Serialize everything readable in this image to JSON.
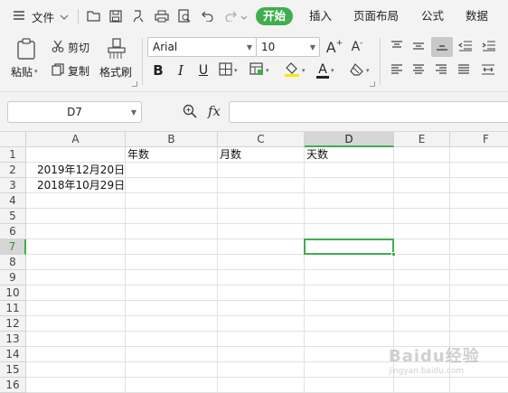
{
  "menubar": {
    "file_label": "文件",
    "tabs": [
      {
        "label": "开始",
        "active": true
      },
      {
        "label": "插入",
        "active": false
      },
      {
        "label": "页面布局",
        "active": false
      },
      {
        "label": "公式",
        "active": false
      },
      {
        "label": "数据",
        "active": false
      }
    ],
    "accent_color": "#3fae4f"
  },
  "ribbon": {
    "paste_label": "粘贴",
    "cut_label": "剪切",
    "copy_label": "复制",
    "format_painter_label": "格式刷",
    "font_name": "Arial",
    "font_size": "10",
    "increase_font_label": "A",
    "decrease_font_label": "A",
    "bold_label": "B",
    "italic_label": "I",
    "underline_label": "U",
    "font_color_label": "A"
  },
  "formula_bar": {
    "name_box": "D7",
    "fx_label": "fx",
    "formula_value": ""
  },
  "sheet": {
    "columns": [
      "A",
      "B",
      "C",
      "D",
      "E",
      "F"
    ],
    "rows": [
      "1",
      "2",
      "3",
      "4",
      "5",
      "6",
      "7",
      "8",
      "9",
      "10",
      "11",
      "12",
      "13",
      "14",
      "15",
      "16"
    ],
    "active_column": "D",
    "active_row": "7",
    "cells": {
      "B1": "年数",
      "C1": "月数",
      "D1": "天数",
      "A2": "2019年12月20日",
      "A3": "2018年10月29日"
    }
  },
  "watermark": {
    "text": "Baidu经验",
    "sub": "jingyan.baidu.com"
  }
}
